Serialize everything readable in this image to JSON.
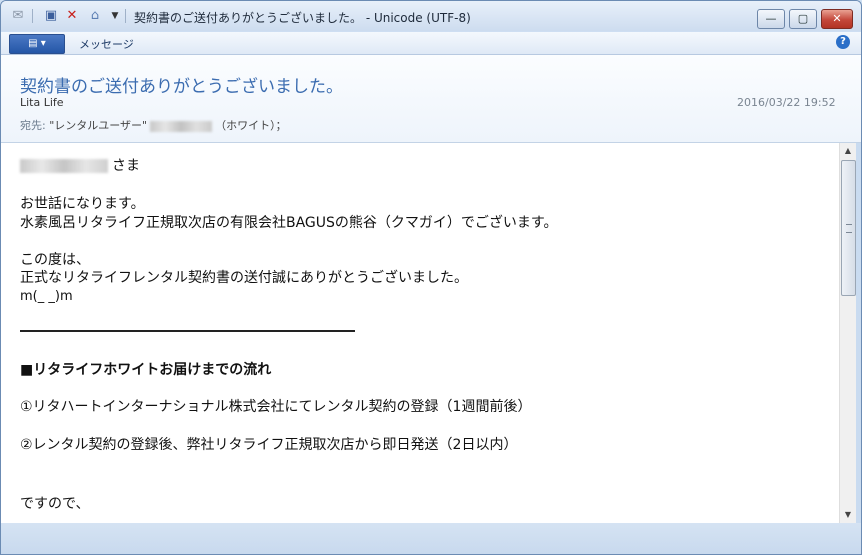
{
  "window": {
    "title": "契約書のご送付ありがとうございました。 - Unicode (UTF-8)",
    "minimize": "—",
    "maximize": "▢",
    "close": "✕"
  },
  "toolbar": {
    "menu_button": "▤ ▾",
    "menu_item": "メッセージ",
    "help": "?"
  },
  "header": {
    "subject": "契約書のご送付ありがとうございました。",
    "sender": "Lita Life",
    "date": "2016/03/22 19:52",
    "to_label": "宛先:",
    "to_value_prefix": "\"レンタルユーザー\"",
    "to_value_suffix": "（ホワイト）；"
  },
  "body": {
    "greeting_suffix": "さま",
    "line1": "お世話になります。",
    "line2": "水素風呂リタライフ正規取次店の有限会社BAGUSの熊谷（クマガイ）でございます。",
    "line3": "この度は、",
    "line4": "正式なリタライフレンタル契約書の送付誠にありがとうございました。",
    "line5": "m(_ _)m",
    "heading": "■リタライフホワイトお届けまでの流れ",
    "step1": "①リタハートインターナショナル株式会社にてレンタル契約の登録（1週間前後）",
    "step2": "②レンタル契約の登録後、弊社リタライフ正規取次店から即日発送（2日以内）",
    "closing": "ですので、"
  },
  "icons": [
    "mail-icon",
    "save-icon",
    "delete-icon",
    "reply-icon",
    "dropdown-icon",
    "help-icon"
  ]
}
